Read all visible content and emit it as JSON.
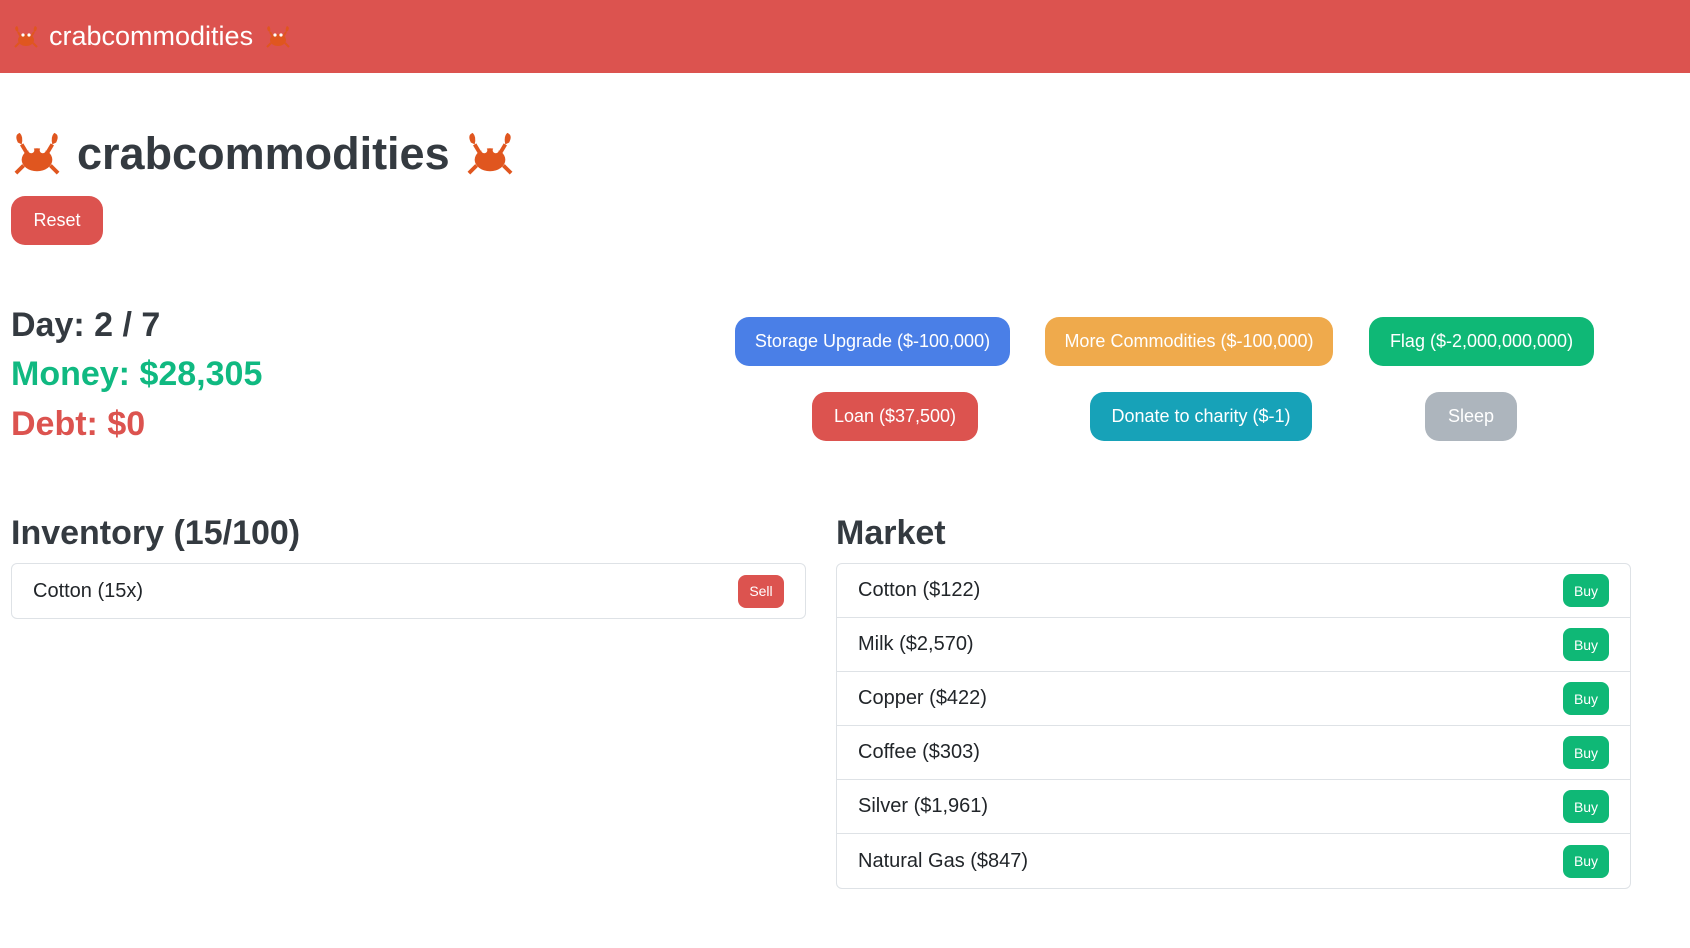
{
  "navbar": {
    "brand": "crabcommodities"
  },
  "header": {
    "title": "crabcommodities",
    "reset_label": "Reset"
  },
  "stats": {
    "day": "Day: 2 / 7",
    "money": "Money: $28,305",
    "debt": "Debt: $0"
  },
  "actions": {
    "storage": "Storage Upgrade ($-100,000)",
    "more": "More Commodities ($-100,000)",
    "flag": "Flag ($-2,000,000,000)",
    "loan": "Loan ($37,500)",
    "donate": "Donate to charity ($-1)",
    "sleep": "Sleep"
  },
  "inventory": {
    "title": "Inventory (15/100)",
    "items": [
      {
        "label": "Cotton (15x)",
        "action": "Sell"
      }
    ]
  },
  "market": {
    "title": "Market",
    "items": [
      {
        "label": "Cotton ($122)",
        "action": "Buy"
      },
      {
        "label": "Milk ($2,570)",
        "action": "Buy"
      },
      {
        "label": "Copper ($422)",
        "action": "Buy"
      },
      {
        "label": "Coffee ($303)",
        "action": "Buy"
      },
      {
        "label": "Silver ($1,961)",
        "action": "Buy"
      },
      {
        "label": "Natural Gas ($847)",
        "action": "Buy"
      }
    ]
  },
  "colors": {
    "danger": "#dc534f",
    "success": "#10b981",
    "primary": "#4a7fe7",
    "warning": "#efaa4c",
    "info": "#17a2b8",
    "secondary": "#adb5bd"
  },
  "icons": {
    "brand_icon": "crab-icon"
  }
}
